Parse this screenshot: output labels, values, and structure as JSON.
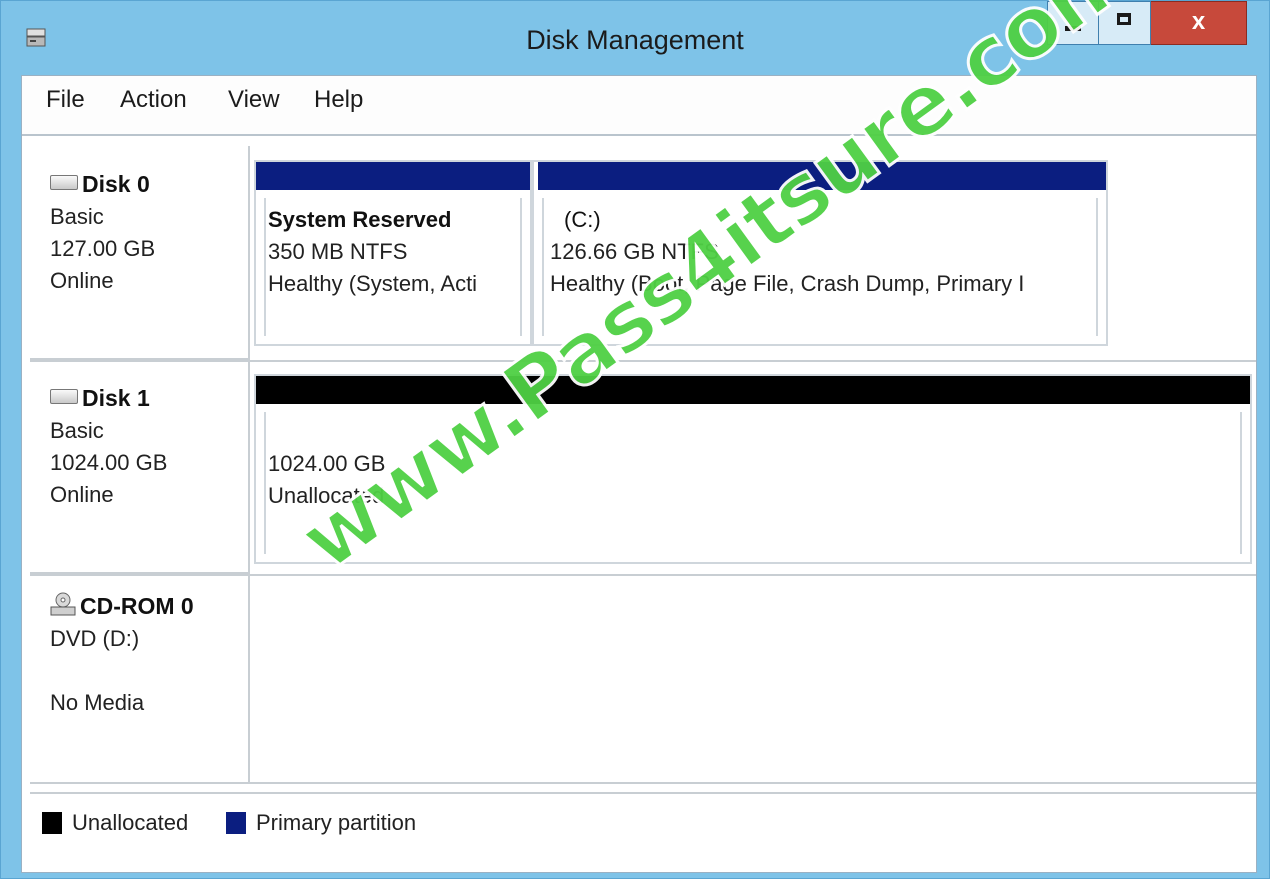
{
  "window": {
    "title": "Disk Management",
    "close_glyph": "x"
  },
  "menu": {
    "items": [
      "File",
      "Action",
      "View",
      "Help"
    ]
  },
  "disks": [
    {
      "name": "Disk 0",
      "type": "Basic",
      "size": "127.00 GB",
      "status": "Online",
      "icon": "hard-disk-icon"
    },
    {
      "name": "Disk 1",
      "type": "Basic",
      "size": "1024.00 GB",
      "status": "Online",
      "icon": "hard-disk-icon"
    },
    {
      "name": "CD-ROM 0",
      "type": "DVD (D:)",
      "size": "",
      "status": "No Media",
      "icon": "cd-rom-icon"
    }
  ],
  "partitions": {
    "disk0": [
      {
        "name": "System Reserved",
        "size": "350 MB NTFS",
        "status": "Healthy (System, Acti",
        "bar_color": "#0b1e80"
      },
      {
        "name": "(C:)",
        "size": "126.66 GB NTFS",
        "status": "Healthy (Boot, Page File, Crash Dump, Primary I",
        "bar_color": "#0b1e80"
      }
    ],
    "disk1": [
      {
        "name": "",
        "size": "1024.00 GB",
        "status": "Unallocated",
        "bar_color": "#000000"
      }
    ]
  },
  "legend": [
    {
      "label": "Unallocated",
      "color": "#000000"
    },
    {
      "label": "Primary partition",
      "color": "#0b1e80"
    }
  ],
  "watermark": "www.Pass4itsure.com"
}
